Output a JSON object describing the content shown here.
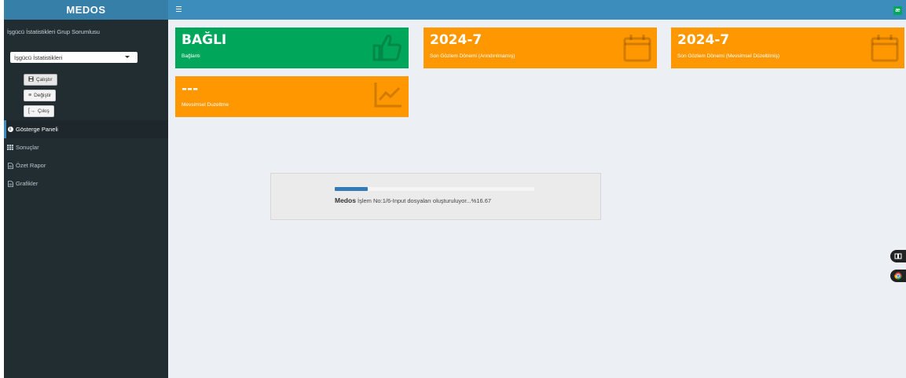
{
  "sidebar": {
    "logo": "MEDOS",
    "group_label": "İşgücü İstatistikleri Grup Sorumlusu",
    "select": {
      "value": "İşgücü İstatistikleri"
    },
    "buttons": {
      "run": "Çalıştır",
      "change": "Değiştir",
      "exit": "Çıkış"
    },
    "nav": [
      "Gösterge Paneli",
      "Sonuçlar",
      "Özet Rapor",
      "Grafikler"
    ]
  },
  "header": {
    "badge": "æ"
  },
  "boxes": [
    {
      "value": "BAĞLI",
      "label": "Bağlantı",
      "color": "#00a65a",
      "icon": "thumbs-up-icon"
    },
    {
      "value": "2024-7",
      "label": "Son Gözlem Dönemi (Arındırılmamış)",
      "color": "#ff9800",
      "icon": "calendar-icon"
    },
    {
      "value": "2024-7",
      "label": "Son Gözlem Dönemi (Mevsimsel Düzeltilmiş)",
      "color": "#ff9800",
      "icon": "calendar-icon"
    },
    {
      "value": "---",
      "label": "Mevsimsel Duzeltme",
      "color": "#ff9800",
      "icon": "line-chart-icon"
    }
  ],
  "progress": {
    "app_name": "Medos",
    "message": "İşlem No:1/6-Input dosyaları oluşturuluyor...%16.67",
    "percent": 16.67
  },
  "colors": {
    "header": "#3c8dbc",
    "sidebar": "#222d32",
    "logo": "#367fa9",
    "progress": "#337ab7"
  }
}
